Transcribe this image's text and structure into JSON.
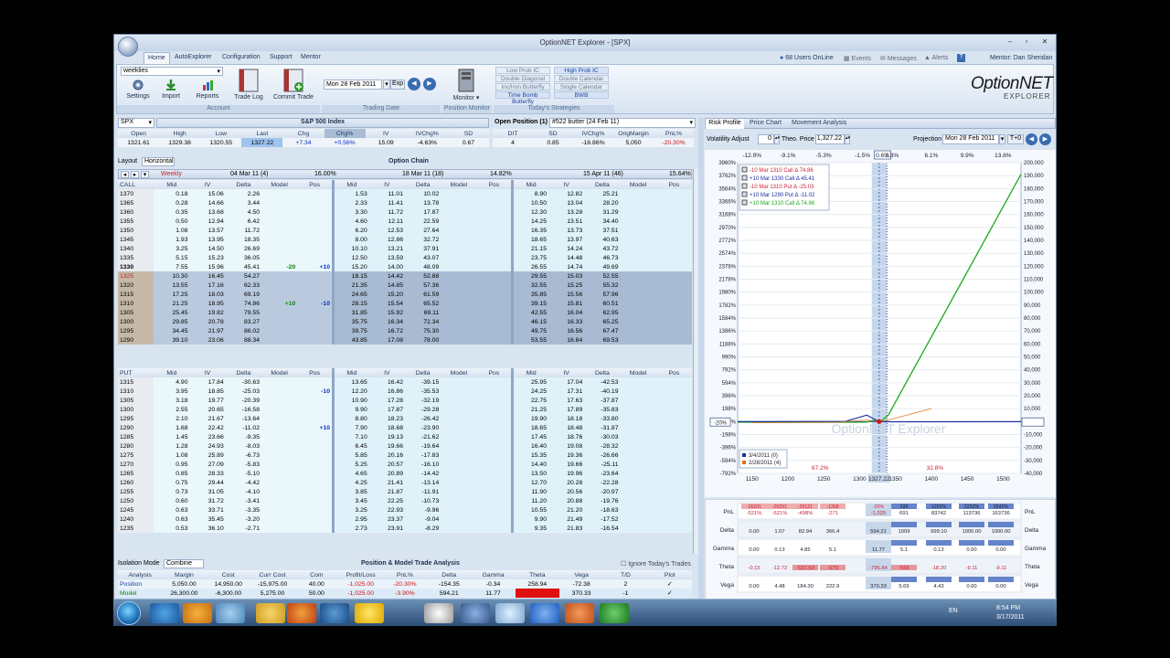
{
  "window": {
    "title": "OptionNET Explorer - [SPX]",
    "minimize": "–",
    "restore": "▫",
    "close": "✕"
  },
  "ribbon_tabs": [
    "Home",
    "AutoExplorer",
    "Configuration",
    "Support",
    "Mentor"
  ],
  "status_bar": {
    "users_online": "68 Users OnLine",
    "events": "Events",
    "messages": "Messages",
    "alerts": "Alerts",
    "mentor": "Mentor: Dan Sheridan"
  },
  "account_group": {
    "dropdown": "weeklies",
    "settings": "Settings",
    "import": "Import",
    "reports": "Reports",
    "trade_log": "Trade Log",
    "commit_trade": "Commit Trade",
    "label": "Account"
  },
  "trading_date": {
    "date": "Mon 28 Feb 2011",
    "exp": "Exp",
    "label": "Trading Date"
  },
  "position_monitor": {
    "monitor": "Monitor",
    "label": "Position Monitor"
  },
  "strategies": {
    "items": [
      "Low Prob IC",
      "High Prob IC",
      "Double Diagonal",
      "Double Calendar",
      "Inc/Iron Butterfly",
      "Single Calendar",
      "Time Bomb Butterfly",
      "BWB"
    ],
    "label": "Today's Strategies"
  },
  "logo": {
    "main": "OptionNET",
    "sub": "EXPLORER"
  },
  "index": {
    "symbol": "SPX",
    "title": "S&P 500 Index",
    "headers": [
      "Open",
      "High",
      "Low",
      "Last",
      "Chg",
      "Chg%",
      "IV",
      "IVChg%",
      "SD"
    ],
    "values": [
      "1321.61",
      "1329.38",
      "1320.55",
      "1327.22",
      "+7.34",
      "+0.56%",
      "15.09",
      "-4.63%",
      "0.67"
    ]
  },
  "open_position": {
    "title": "Open Position (1)",
    "value": "#522 butter (24 Feb 11)",
    "headers": [
      "DIT",
      "SD",
      "IVChg%",
      "OrigMargin",
      "PnL%"
    ],
    "values": [
      "4",
      "0.85",
      "-16.86%",
      "5,050",
      "-20.30%"
    ]
  },
  "option_chain": {
    "layout_label": "Layout",
    "layout_value": "Horizontal",
    "title": "Option Chain",
    "expirations": [
      {
        "tag": "Weekly",
        "date": "04 Mar 11 (4)",
        "iv": "16.00%"
      },
      {
        "tag": "",
        "date": "18 Mar 11 (18)",
        "iv": "14.82%"
      },
      {
        "tag": "",
        "date": "15 Apr 11 (46)",
        "iv": "15.64%"
      }
    ],
    "call_headers": [
      "CALL",
      "Mid",
      "IV",
      "Delta",
      "Model",
      "Pos"
    ],
    "put_headers": [
      "PUT",
      "Mid",
      "IV",
      "Delta",
      "Model",
      "Pos"
    ],
    "sub_headers": [
      "Mid",
      "IV",
      "Delta",
      "Model",
      "Pos"
    ],
    "calls": [
      [
        "1370",
        "0.18",
        "15.06",
        "2.26",
        "",
        "",
        "1.53",
        "11.01",
        "10.02",
        "",
        "",
        "8.90",
        "12.82",
        "25.21",
        "",
        ""
      ],
      [
        "1365",
        "0.28",
        "14.66",
        "3.44",
        "",
        "",
        "2.33",
        "11.41",
        "13.78",
        "",
        "",
        "10.50",
        "13.04",
        "28.20",
        "",
        ""
      ],
      [
        "1360",
        "0.35",
        "13.68",
        "4.50",
        "",
        "",
        "3.30",
        "11.72",
        "17.87",
        "",
        "",
        "12.30",
        "13.28",
        "31.29",
        "",
        ""
      ],
      [
        "1355",
        "0.50",
        "12.94",
        "6.42",
        "",
        "",
        "4.60",
        "12.11",
        "22.59",
        "",
        "",
        "14.25",
        "13.51",
        "34.40",
        "",
        ""
      ],
      [
        "1350",
        "1.08",
        "13.57",
        "11.72",
        "",
        "",
        "6.20",
        "12.53",
        "27.64",
        "",
        "",
        "16.35",
        "13.73",
        "37.51",
        "",
        ""
      ],
      [
        "1345",
        "1.93",
        "13.95",
        "18.35",
        "",
        "",
        "8.00",
        "12.86",
        "32.72",
        "",
        "",
        "18.65",
        "13.97",
        "40.63",
        "",
        ""
      ],
      [
        "1340",
        "3.25",
        "14.50",
        "26.69",
        "",
        "",
        "10.10",
        "13.21",
        "37.91",
        "",
        "",
        "21.15",
        "14.24",
        "43.72",
        "",
        ""
      ],
      [
        "1335",
        "5.15",
        "15.23",
        "36.05",
        "",
        "",
        "12.50",
        "13.59",
        "43.07",
        "",
        "",
        "23.75",
        "14.48",
        "46.73",
        "",
        ""
      ],
      [
        "1330",
        "7.55",
        "15.96",
        "45.41",
        "-20",
        "+10",
        "15.20",
        "14.00",
        "48.09",
        "",
        "",
        "26.55",
        "14.74",
        "49.69",
        "",
        ""
      ],
      [
        "1325",
        "10.30",
        "16.45",
        "54.27",
        "",
        "",
        "18.15",
        "14.42",
        "52.88",
        "",
        "",
        "29.55",
        "15.03",
        "52.55",
        "",
        ""
      ],
      [
        "1320",
        "13.55",
        "17.16",
        "62.33",
        "",
        "",
        "21.35",
        "14.85",
        "57.36",
        "",
        "",
        "32.55",
        "15.25",
        "55.32",
        "",
        ""
      ],
      [
        "1315",
        "17.25",
        "18.03",
        "69.19",
        "",
        "",
        "24.65",
        "15.20",
        "61.59",
        "",
        "",
        "35.85",
        "15.56",
        "57.96",
        "",
        ""
      ],
      [
        "1310",
        "21.25",
        "18.95",
        "74.86",
        "+10",
        "-10",
        "28.15",
        "15.54",
        "65.52",
        "",
        "",
        "39.15",
        "15.81",
        "60.51",
        "",
        ""
      ],
      [
        "1305",
        "25.45",
        "19.82",
        "79.55",
        "",
        "",
        "31.85",
        "15.92",
        "69.11",
        "",
        "",
        "42.55",
        "16.04",
        "62.95",
        "",
        ""
      ],
      [
        "1300",
        "29.85",
        "20.78",
        "83.27",
        "",
        "",
        "35.75",
        "16.34",
        "72.34",
        "",
        "",
        "46.15",
        "16.33",
        "65.25",
        "",
        ""
      ],
      [
        "1295",
        "34.45",
        "21.97",
        "86.02",
        "",
        "",
        "39.75",
        "16.72",
        "75.30",
        "",
        "",
        "49.75",
        "16.56",
        "67.47",
        "",
        ""
      ],
      [
        "1290",
        "39.10",
        "23.06",
        "88.34",
        "",
        "",
        "43.85",
        "17.08",
        "78.00",
        "",
        "",
        "53.55",
        "16.84",
        "69.53",
        "",
        ""
      ]
    ],
    "puts": [
      [
        "1315",
        "4.90",
        "17.84",
        "-30.63",
        "",
        "",
        "13.65",
        "16.42",
        "-39.15",
        "",
        "",
        "25.95",
        "17.04",
        "-42.53",
        "",
        ""
      ],
      [
        "1310",
        "3.95",
        "18.85",
        "-25.03",
        "",
        "-10",
        "12.20",
        "16.86",
        "-35.53",
        "",
        "",
        "24.25",
        "17.31",
        "-40.19",
        "",
        ""
      ],
      [
        "1305",
        "3.18",
        "19.77",
        "-20.39",
        "",
        "",
        "10.90",
        "17.28",
        "-32.19",
        "",
        "",
        "22.75",
        "17.63",
        "-37.87",
        "",
        ""
      ],
      [
        "1300",
        "2.55",
        "20.65",
        "-16.58",
        "",
        "",
        "9.90",
        "17.87",
        "-29.28",
        "",
        "",
        "21.25",
        "17.89",
        "-35.83",
        "",
        ""
      ],
      [
        "1295",
        "2.10",
        "21.67",
        "-13.64",
        "",
        "",
        "8.80",
        "18.23",
        "-26.42",
        "",
        "",
        "19.90",
        "18.18",
        "-33.80",
        "",
        ""
      ],
      [
        "1290",
        "1.68",
        "22.42",
        "-11.02",
        "",
        "+10",
        "7.90",
        "18.68",
        "-23.90",
        "",
        "",
        "18.65",
        "18.48",
        "-31.87",
        "",
        ""
      ],
      [
        "1285",
        "1.45",
        "23.66",
        "-9.35",
        "",
        "",
        "7.10",
        "19.13",
        "-21.62",
        "",
        "",
        "17.45",
        "18.76",
        "-30.03",
        "",
        ""
      ],
      [
        "1280",
        "1.28",
        "24.93",
        "-8.03",
        "",
        "",
        "6.45",
        "19.66",
        "-19.64",
        "",
        "",
        "16.40",
        "19.08",
        "-28.32",
        "",
        ""
      ],
      [
        "1275",
        "1.08",
        "25.89",
        "-6.73",
        "",
        "",
        "5.85",
        "20.16",
        "-17.83",
        "",
        "",
        "15.35",
        "19.36",
        "-26.66",
        "",
        ""
      ],
      [
        "1270",
        "0.95",
        "27.09",
        "-5.83",
        "",
        "",
        "5.25",
        "20.57",
        "-16.10",
        "",
        "",
        "14.40",
        "19.66",
        "-25.11",
        "",
        ""
      ],
      [
        "1265",
        "0.85",
        "28.33",
        "-5.10",
        "",
        "",
        "4.65",
        "20.89",
        "-14.42",
        "",
        "",
        "13.50",
        "19.96",
        "-23.64",
        "",
        ""
      ],
      [
        "1260",
        "0.75",
        "29.44",
        "-4.42",
        "",
        "",
        "4.25",
        "21.41",
        "-13.14",
        "",
        "",
        "12.70",
        "20.28",
        "-22.28",
        "",
        ""
      ],
      [
        "1255",
        "0.73",
        "31.05",
        "-4.10",
        "",
        "",
        "3.85",
        "21.87",
        "-11.91",
        "",
        "",
        "11.90",
        "20.56",
        "-20.97",
        "",
        ""
      ],
      [
        "1250",
        "0.60",
        "31.72",
        "-3.41",
        "",
        "",
        "3.45",
        "22.25",
        "-10.73",
        "",
        "",
        "11.20",
        "20.88",
        "-19.76",
        "",
        ""
      ],
      [
        "1245",
        "0.63",
        "33.71",
        "-3.35",
        "",
        "",
        "3.25",
        "22.93",
        "-9.96",
        "",
        "",
        "10.55",
        "21.20",
        "-18.63",
        "",
        ""
      ],
      [
        "1240",
        "0.63",
        "35.45",
        "-3.20",
        "",
        "",
        "2.95",
        "23.37",
        "-9.04",
        "",
        "",
        "9.90",
        "21.49",
        "-17.52",
        "",
        ""
      ],
      [
        "1235",
        "0.53",
        "36.10",
        "-2.71",
        "",
        "",
        "2.73",
        "23.91",
        "-8.29",
        "",
        "",
        "9.35",
        "21.83",
        "-16.54",
        "",
        ""
      ]
    ]
  },
  "analysis": {
    "isolation_label": "Isolation Mode",
    "isolation_value": "Combine",
    "title": "Position & Model Trade Analysis",
    "ignore_label": "Ignore Today's Trades",
    "headers": [
      "Analysis",
      "Margin",
      "Cost",
      "Curr Cost",
      "Com",
      "Profit/Loss",
      "PnL%",
      "Delta",
      "Gamma",
      "Theta",
      "Vega",
      "T/D",
      "Plot"
    ],
    "rows": [
      [
        "Position",
        "5,050.00",
        "14,950.00",
        "-15,975.00",
        "40.00",
        "-1,025.00",
        "-20.30%",
        "-154.35",
        "-0.34",
        "258.94",
        "-72.38",
        "2",
        "✓"
      ],
      [
        "Model",
        "26,300.00",
        "-6,300.00",
        "5,275.00",
        "50.00",
        "-1,025.00",
        "-3.90%",
        "594.21",
        "11.77",
        "-796.84",
        "370.33",
        "-1",
        "✓"
      ]
    ]
  },
  "risk": {
    "tabs": [
      "Risk Profile",
      "Price Chart",
      "Movement Analysis"
    ],
    "vol_adjust_label": "Volatility Adjust",
    "vol_adjust_value": "0",
    "theo_label": "Theo. Price",
    "theo_value": "1,327.22",
    "projection_label": "Projection",
    "projection_value": "Mon 28 Feb 2011",
    "tplus": "T+0",
    "pct_labels": [
      "-12.9%",
      "-9.1%",
      "-5.3%",
      "-1.5%",
      "0.6%",
      "2.3%",
      "6.1%",
      "9.9%",
      "13.6%"
    ],
    "legend": [
      "-10 Mar 1310 Call Δ 74.86",
      "+10 Mar 1330 Call Δ 45.41",
      "-10 Mar 1310 Put Δ -25.03",
      "+10 Mar 1290 Put Δ -11.02",
      "+10 Mar 1310 Call Δ 74.86"
    ],
    "date_legend": [
      "3/4/2011 (0)",
      "2/28/2011 (4)"
    ],
    "prob_left": "67.2%",
    "prob_right": "32.8%",
    "left_axis": [
      "3960%",
      "3762%",
      "3564%",
      "3366%",
      "3168%",
      "2970%",
      "2772%",
      "2574%",
      "2376%",
      "2178%",
      "1980%",
      "1782%",
      "1584%",
      "1386%",
      "1188%",
      "990%",
      "792%",
      "594%",
      "396%",
      "198%",
      "-20%",
      "-198%",
      "-396%",
      "-594%",
      "-792%"
    ],
    "right_axis": [
      "200,000",
      "190,000",
      "180,000",
      "170,000",
      "160,000",
      "150,000",
      "140,000",
      "130,000",
      "120,000",
      "110,000",
      "100,000",
      "90,000",
      "80,000",
      "70,000",
      "60,000",
      "50,000",
      "40,000",
      "30,000",
      "20,000",
      "10,000",
      "-1,025",
      "-10,000",
      "-20,000",
      "-30,000",
      "-40,000"
    ],
    "x_axis": [
      "1150",
      "1200",
      "1250",
      "1300",
      "1327.22",
      "1350",
      "1400",
      "1450",
      "1500"
    ],
    "watermark": "OptionNET Explorer",
    "greek_labels": [
      "PnL",
      "Delta",
      "Gamma",
      "Theta",
      "Vega"
    ],
    "greek_rows": [
      [
        "-521%",
        "-521%",
        "-498%",
        "-271",
        "-1,025",
        "691",
        "83742",
        "113736",
        "163736"
      ],
      [
        "0.00",
        "1.07",
        "82.94",
        "366.4",
        "594.21",
        "1009",
        "999.10",
        "1000.00",
        "1000.00"
      ],
      [
        "0.00",
        "0.13",
        "4.85",
        "5.1",
        "11.77",
        "5.1",
        "0.13",
        "0.00",
        "0.00"
      ],
      [
        "-0.15",
        "-12.72",
        "-531.69",
        "-679",
        "-796.84",
        "-556",
        "-18.20",
        "-9.11",
        "-9.11"
      ],
      [
        "0.00",
        "4.48",
        "184.30",
        "222.9",
        "370.33",
        "5.69",
        "4.43",
        "0.00",
        "0.00"
      ]
    ],
    "pnl_sub": [
      "-26291",
      "-26291",
      "-25121",
      "-1368",
      "-20%",
      "298",
      "1262%",
      "2252%",
      "3242%"
    ]
  },
  "taskbar": {
    "lang": "EN",
    "time": "8:54 PM",
    "date": "3/17/2011"
  },
  "colors": {
    "accent": "#1c3f6e",
    "itm": "#cfe0ee",
    "otm": "#eef8fc",
    "red": "#d01010",
    "green": "#108010",
    "blue": "#1030c0"
  }
}
